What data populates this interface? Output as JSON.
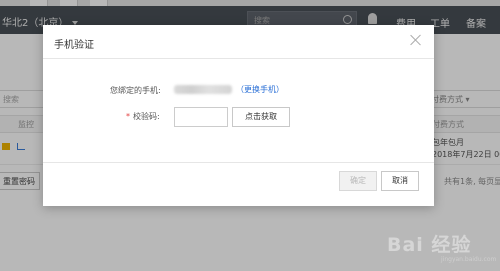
{
  "topbar": {
    "region": "华北2（北京）",
    "search_placeholder": "搜索",
    "menu": [
      "费用",
      "工单",
      "备案"
    ]
  },
  "background": {
    "search_placeholder": "搜索",
    "filter_label": "付费方式",
    "headers": [
      "监控",
      "付费方式"
    ],
    "row": {
      "billing": "包年包月",
      "date": "2018年7月22日 00:0"
    },
    "reset_button": "重置密码",
    "pagination": "共有1条, 每页显示"
  },
  "dialog": {
    "title": "手机验证",
    "phone_label": "您绑定的手机:",
    "change_link": "更换手机",
    "code_label": "校验码:",
    "code_value": "",
    "get_code_button": "点击获取",
    "confirm_button": "确定",
    "cancel_button": "取消"
  },
  "watermark": {
    "text": "Bai 经验",
    "url": "jingyan.baidu.com"
  }
}
